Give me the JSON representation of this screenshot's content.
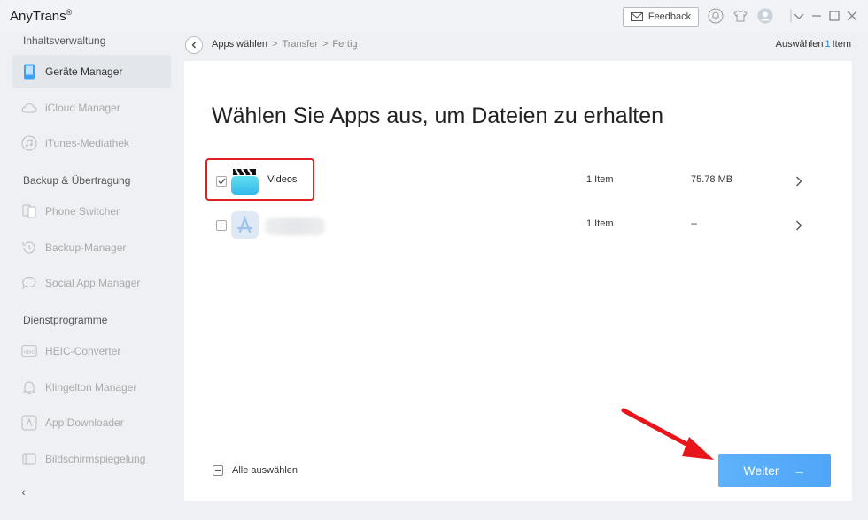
{
  "app": {
    "title": "AnyTrans",
    "mark": "®"
  },
  "titlebar": {
    "feedback_label": "Feedback"
  },
  "sidebar": {
    "sections": [
      {
        "label": "Inhaltsverwaltung",
        "items": [
          {
            "label": "Geräte Manager",
            "icon": "phone-icon",
            "active": true
          },
          {
            "label": "iCloud Manager",
            "icon": "cloud-icon"
          },
          {
            "label": "iTunes-Mediathek",
            "icon": "music-icon"
          }
        ]
      },
      {
        "label": "Backup & Übertragung",
        "items": [
          {
            "label": "Phone Switcher",
            "icon": "switch-icon"
          },
          {
            "label": "Backup-Manager",
            "icon": "backup-icon"
          },
          {
            "label": "Social App Manager",
            "icon": "chat-icon"
          }
        ]
      },
      {
        "label": "Dienstprogramme",
        "items": [
          {
            "label": "HEIC-Converter",
            "icon": "heic-icon",
            "badge": "HEIC"
          },
          {
            "label": "Klingelton Manager",
            "icon": "bell-icon"
          },
          {
            "label": "App Downloader",
            "icon": "app-store-icon"
          },
          {
            "label": "Bildschirmspiegelung",
            "icon": "mirror-icon"
          }
        ]
      }
    ],
    "collapse_glyph": "‹"
  },
  "breadcrumb": {
    "items": [
      "Apps wählen",
      "Transfer",
      "Fertig"
    ],
    "separator": ">",
    "selection_prefix": "Auswählen",
    "selection_count": "1",
    "selection_suffix": "Item"
  },
  "main": {
    "heading": "Wählen Sie Apps aus, um Dateien zu erhalten",
    "rows": [
      {
        "name": "Videos",
        "count": "1 Item",
        "size": "75.78 MB",
        "checked": true,
        "icon": "videos-app-icon"
      },
      {
        "name": "",
        "count": "1 Item",
        "size": "--",
        "checked": false,
        "icon": "app-store-app-icon"
      }
    ],
    "select_all_label": "Alle auswählen",
    "next_label": "Weiter",
    "next_arrow": "→"
  },
  "colors": {
    "accent": "#4FA5F8",
    "highlight": "#E02020",
    "selection_count": "#1E88E5"
  }
}
